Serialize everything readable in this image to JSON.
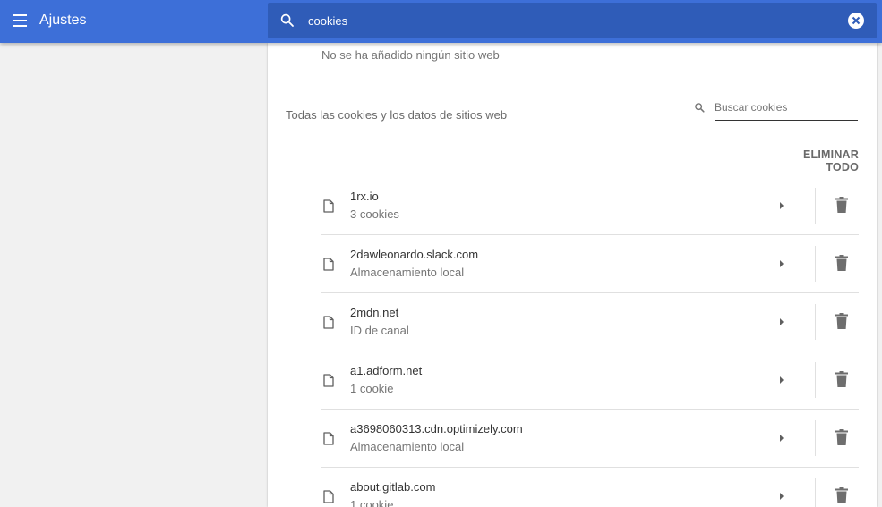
{
  "header": {
    "title": "Ajustes",
    "search_value": "cookies",
    "accent_color": "#3d6fd8"
  },
  "main": {
    "empty_message": "No se ha añadido ningún sitio web",
    "section_title": "Todas las cookies y los datos de sitios web",
    "search_cookies_placeholder": "Buscar cookies",
    "remove_all_label": "ELIMINAR TODO",
    "sites": [
      {
        "name": "1rx.io",
        "detail": "3 cookies"
      },
      {
        "name": "2dawleonardo.slack.com",
        "detail": "Almacenamiento local"
      },
      {
        "name": "2mdn.net",
        "detail": "ID de canal"
      },
      {
        "name": "a1.adform.net",
        "detail": "1 cookie"
      },
      {
        "name": "a3698060313.cdn.optimizely.com",
        "detail": "Almacenamiento local"
      },
      {
        "name": "about.gitlab.com",
        "detail": "1 cookie"
      }
    ]
  },
  "icons": {
    "menu": "menu-icon",
    "search": "search-icon",
    "clear": "clear-icon",
    "file": "file-icon",
    "expand": "arrow-right-icon",
    "delete": "trash-icon"
  }
}
